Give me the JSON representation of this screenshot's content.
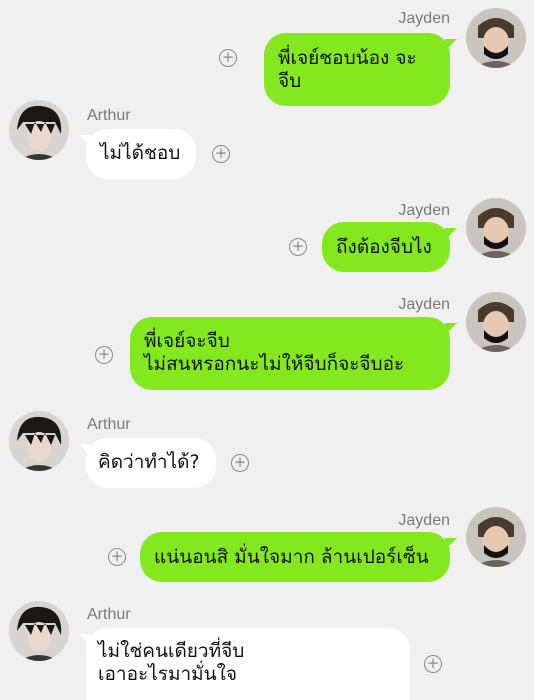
{
  "messages": [
    {
      "sender": "Jayden",
      "side": "right",
      "text": "พี่เจย์ชอบน้อง จะจีบ",
      "avatar": "jayden-avatar"
    },
    {
      "sender": "Arthur",
      "side": "left",
      "text": "ไม่ได้ชอบ",
      "avatar": "arthur-avatar"
    },
    {
      "sender": "Jayden",
      "side": "right",
      "text": "ถึงต้องจีบไง",
      "avatar": "jayden-avatar"
    },
    {
      "sender": "Jayden",
      "side": "right",
      "text": "พี่เจย์จะจีบ\nไม่สนหรอกนะไม่ให้จีบก็จะจีบอ่ะ",
      "avatar": "jayden-avatar"
    },
    {
      "sender": "Arthur",
      "side": "left",
      "text": "คิดว่าทำได้?",
      "avatar": "arthur-avatar"
    },
    {
      "sender": "Jayden",
      "side": "right",
      "text": "แน่นอนสิ มั่นใจมาก ล้านเปอร์เซ็น",
      "avatar": "jayden-avatar"
    },
    {
      "sender": "Arthur",
      "side": "left",
      "text": "ไม่ใช่คนเดียวที่จีบ\nเอาอะไรมามั่นใจ",
      "avatar": "arthur-avatar"
    }
  ],
  "icons": {
    "reaction": "plus-circle-icon"
  },
  "colors": {
    "background": "#f0f0f0",
    "outgoing_bubble": "#84e81f",
    "incoming_bubble": "#ffffff",
    "name_text": "#7a7a7a"
  }
}
